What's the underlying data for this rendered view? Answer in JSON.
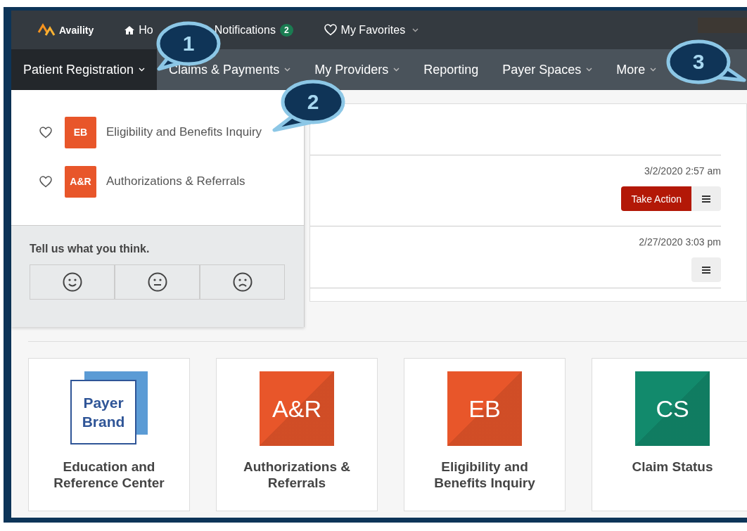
{
  "top_nav": {
    "logo": "Availity",
    "items": [
      {
        "kind": "home",
        "label": "Ho"
      },
      {
        "kind": "notifications",
        "label": "Notifications",
        "badge": "2"
      },
      {
        "kind": "favorites",
        "label": "My Favorites"
      }
    ]
  },
  "main_nav": [
    {
      "label": "Patient Registration",
      "selected": true,
      "dropdown": true
    },
    {
      "label": "Claims & Payments",
      "selected": false,
      "dropdown": true
    },
    {
      "label": "My Providers",
      "selected": false,
      "dropdown": true
    },
    {
      "label": "Reporting",
      "selected": false,
      "dropdown": false
    },
    {
      "label": "Payer Spaces",
      "selected": false,
      "dropdown": true
    },
    {
      "label": "More",
      "selected": false,
      "dropdown": true
    }
  ],
  "dropdown_menu": {
    "items": [
      {
        "favorite": false,
        "tile": "EB",
        "color": "#e8562a",
        "label": "Eligibility and Benefits Inquiry"
      },
      {
        "favorite": false,
        "tile": "A&R",
        "color": "#e8562a",
        "label": "Authorizations & Referrals"
      }
    ],
    "feedback": {
      "prompt": "Tell us what you think.",
      "options": [
        {
          "kind": "happy"
        },
        {
          "kind": "neutral"
        },
        {
          "kind": "sad"
        }
      ]
    }
  },
  "notifications": [
    {
      "time": "3/2/2020 2:57 am",
      "action": "Take Action"
    },
    {
      "time": "2/27/2020 3:03 pm"
    }
  ],
  "tiles": [
    {
      "kind": "brand",
      "icon_lines": [
        "Payer",
        "Brand"
      ],
      "title": "Education and Reference Center"
    },
    {
      "kind": "app",
      "icon": "A&R",
      "color": "#e8562a",
      "title": "Authorizations & Referrals"
    },
    {
      "kind": "app",
      "icon": "EB",
      "color": "#e8562a",
      "title": "Eligibility and Benefits Inquiry"
    },
    {
      "kind": "app",
      "icon": "CS",
      "color": "#128a6c",
      "title": "Claim Status"
    }
  ],
  "callouts": [
    {
      "number": "1"
    },
    {
      "number": "2"
    },
    {
      "number": "3"
    }
  ]
}
